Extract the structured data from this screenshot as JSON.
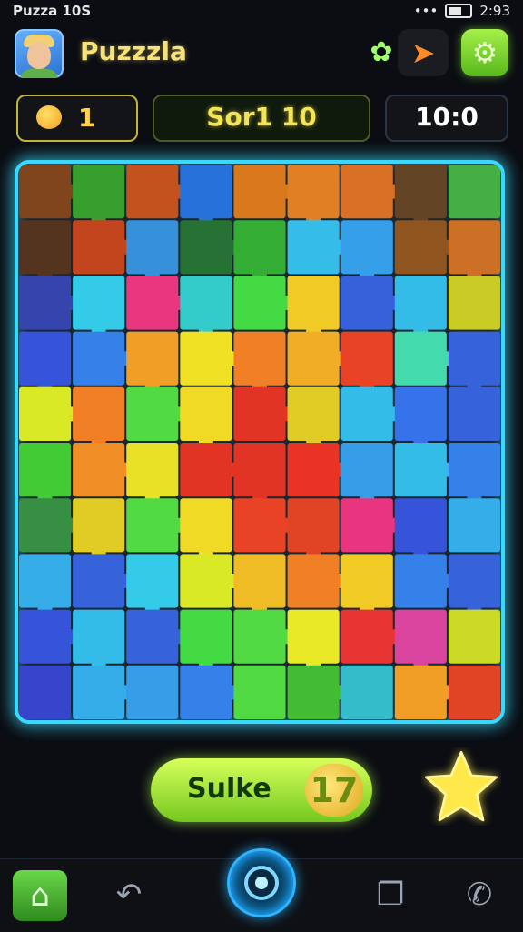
{
  "status_bar": {
    "left_text": "Puzza 10S",
    "time": "2:93"
  },
  "header": {
    "title": "Puzzzla",
    "avatar_icon": "player-avatar",
    "puzzle_icon": "puzzle-piece-icon",
    "share_icon": "arrow-share-icon",
    "settings_icon": "gear-icon"
  },
  "stats": {
    "coins": "1",
    "score": "Sor1 10",
    "timer": "10:0"
  },
  "board": {
    "rows": 10,
    "cols": 9,
    "tiles": [
      "#7a3a10",
      "#2a9a20",
      "#c04810",
      "#1a6ad8",
      "#d87010",
      "#e07818",
      "#d86818",
      "#5a3a18",
      "#3aaa3a",
      "#4a2810",
      "#c03a10",
      "#2a8ad8",
      "#186a28",
      "#28a828",
      "#2ab8e8",
      "#2a9ae8",
      "#8a4a10",
      "#c86818",
      "#2a3aa8",
      "#28c8e8",
      "#e82a78",
      "#28c8c8",
      "#38d838",
      "#f0c818",
      "#2a58d8",
      "#28b8e8",
      "#c8c818",
      "#2a4ad8",
      "#2a7ae8",
      "#f09818",
      "#f0e018",
      "#f07818",
      "#f0a818",
      "#e83818",
      "#38d8a8",
      "#2a5ad8",
      "#d8e818",
      "#f07818",
      "#48d838",
      "#f0d818",
      "#e02818",
      "#e0c818",
      "#28b8e8",
      "#2a6ae8",
      "#2a5ad8",
      "#38c828",
      "#f08818",
      "#e8e018",
      "#e02818",
      "#e02818",
      "#e82818",
      "#2a98e8",
      "#28b8e8",
      "#2a7ae8",
      "#2a8838",
      "#e0c818",
      "#48d838",
      "#f0d818",
      "#e83818",
      "#e03818",
      "#e82878",
      "#2a4ad8",
      "#28a8e8",
      "#28a8e8",
      "#2a5ad8",
      "#28c8e8",
      "#d8e818",
      "#f0b818",
      "#f07818",
      "#f0c818",
      "#2a7ae8",
      "#2a5ad8",
      "#2a4ad8",
      "#28b8e8",
      "#2a5ad8",
      "#38d838",
      "#48d838",
      "#e8e818",
      "#e82828",
      "#d83898",
      "#c8d818",
      "#2a3ac8",
      "#28a8e8",
      "#2a98e8",
      "#2a7ae8",
      "#48d838",
      "#38b828",
      "#28b8c8",
      "#f09818",
      "#e03818"
    ]
  },
  "actions": {
    "primary_label": "Sulke",
    "primary_badge": "17",
    "star_icon": "star-icon"
  },
  "navbar": {
    "home_icon": "home-icon",
    "back_icon": "undo-arrow-icon",
    "center_icon": "target-ring-icon",
    "recent_icon": "recent-apps-icon",
    "phone_icon": "phone-icon"
  }
}
